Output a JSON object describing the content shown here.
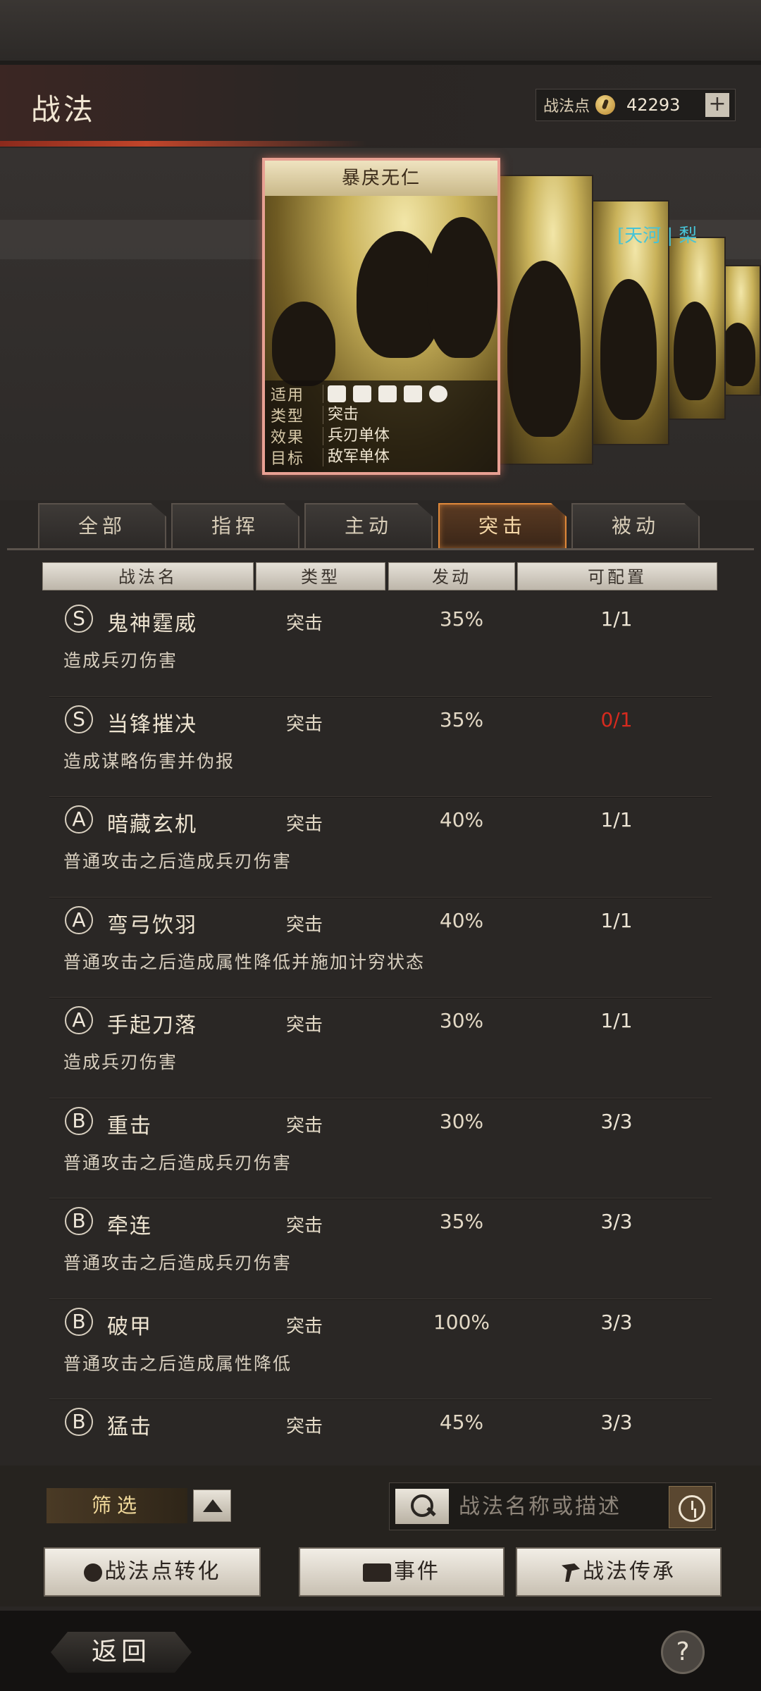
{
  "header": {
    "title": "战法",
    "points_label": "战法点",
    "points_value": "42293",
    "plus_label": "+"
  },
  "featured_card": {
    "title": "暴戾无仁",
    "source_tag": "[天河 | 梨",
    "troop_icons": [
      "cavalry-icon",
      "shield-icon",
      "bow-icon",
      "spear-icon",
      "wheel-icon"
    ],
    "info": [
      {
        "key": "适用",
        "value": ""
      },
      {
        "key": "类型",
        "value": "突击"
      },
      {
        "key": "效果",
        "value": "兵刃单体"
      },
      {
        "key": "目标",
        "value": "敌军单体"
      }
    ]
  },
  "tabs": [
    "全部",
    "指挥",
    "主动",
    "突击",
    "被动"
  ],
  "active_tab": "突击",
  "columns": [
    "战法名",
    "类型",
    "发动",
    "可配置"
  ],
  "skills": [
    {
      "grade": "S",
      "name": "鬼神霆威",
      "type": "突击",
      "rate": "35%",
      "slots": "1/1",
      "desc": "造成兵刃伤害"
    },
    {
      "grade": "S",
      "name": "当锋摧决",
      "type": "突击",
      "rate": "35%",
      "slots": "0/1",
      "desc": "造成谋略伤害并伪报"
    },
    {
      "grade": "A",
      "name": "暗藏玄机",
      "type": "突击",
      "rate": "40%",
      "slots": "1/1",
      "desc": "普通攻击之后造成兵刃伤害"
    },
    {
      "grade": "A",
      "name": "弯弓饮羽",
      "type": "突击",
      "rate": "40%",
      "slots": "1/1",
      "desc": "普通攻击之后造成属性降低并施加计穷状态"
    },
    {
      "grade": "A",
      "name": "手起刀落",
      "type": "突击",
      "rate": "30%",
      "slots": "1/1",
      "desc": "造成兵刃伤害"
    },
    {
      "grade": "B",
      "name": "重击",
      "type": "突击",
      "rate": "30%",
      "slots": "3/3",
      "desc": "普通攻击之后造成兵刃伤害"
    },
    {
      "grade": "B",
      "name": "牵连",
      "type": "突击",
      "rate": "35%",
      "slots": "3/3",
      "desc": "普通攻击之后造成兵刃伤害"
    },
    {
      "grade": "B",
      "name": "破甲",
      "type": "突击",
      "rate": "100%",
      "slots": "3/3",
      "desc": "普通攻击之后造成属性降低"
    },
    {
      "grade": "B",
      "name": "猛击",
      "type": "突击",
      "rate": "45%",
      "slots": "3/3",
      "desc": ""
    }
  ],
  "controls": {
    "filter_label": "筛选",
    "search_placeholder": "战法名称或描述",
    "convert_label": "战法点转化",
    "event_label": "事件",
    "inherit_label": "战法传承"
  },
  "footer": {
    "back_label": "返回",
    "help_label": "?"
  },
  "colors": {
    "accent_orange": "#e0893a",
    "unavailable_red": "#d62a1e",
    "tag_cyan": "#47c3d6"
  }
}
